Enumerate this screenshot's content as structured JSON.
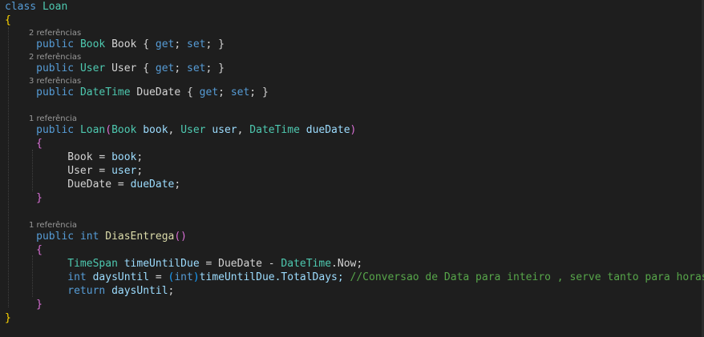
{
  "code": {
    "kw_class": "class",
    "class_name": "Loan",
    "open_brace": "{",
    "close_brace": "}",
    "ref_book": "2 referências",
    "prop_book_public": "public",
    "prop_book_type": "Book",
    "prop_book_name": "Book",
    "prop_open": "{",
    "kw_get": "get",
    "semi": ";",
    "kw_set": "set",
    "prop_close": "}",
    "ref_user": "2 referências",
    "prop_user_public": "public",
    "prop_user_type": "User",
    "prop_user_name": "User",
    "ref_duedate": "3 referências",
    "prop_duedate_public": "public",
    "prop_duedate_type": "DateTime",
    "prop_duedate_name": "DueDate",
    "ref_ctor": "1 referência",
    "ctor_public": "public",
    "ctor_name": "Loan",
    "ctor_lparen": "(",
    "ctor_p1_type": "Book",
    "ctor_p1_name": "book",
    "comma": ",",
    "ctor_p2_type": "User",
    "ctor_p2_name": "user",
    "ctor_p3_type": "DateTime",
    "ctor_p3_name": "dueDate",
    "ctor_rparen": ")",
    "ctor_open": "{",
    "assign1_lhs": "Book",
    "assign1_op": "=",
    "assign1_rhs": "book",
    "assign2_lhs": "User",
    "assign2_op": "=",
    "assign2_rhs": "user",
    "assign3_lhs": "DueDate",
    "assign3_op": "=",
    "assign3_rhs": "dueDate",
    "ctor_close": "}",
    "ref_method": "1 referência",
    "m_public": "public",
    "m_int": "int",
    "m_name": "DiasEntrega",
    "m_parens": "()",
    "m_open": "{",
    "s1_type": "TimeSpan",
    "s1_var": "timeUntilDue",
    "s1_eq": "=",
    "s1_lhs": "DueDate",
    "s1_minus": "-",
    "s1_dt": "DateTime",
    "s1_now": ".Now;",
    "s2_int": "int",
    "s2_var": "daysUntil",
    "s2_eq": "=",
    "s2_lparen": "(",
    "s2_cast": "int",
    "s2_rparen": ")",
    "s2_expr": "timeUntilDue.TotalDays;",
    "s2_comment": "//Conversao de Data para inteiro , serve tanto para horas dias",
    "s3_return": "return",
    "s3_var": "daysUntil",
    "m_close": "}",
    "class_close": "}"
  },
  "colors": {
    "background": "#1e1e1e",
    "keyword": "#569cd6",
    "type": "#4ec9b0",
    "method": "#dcdcaa",
    "parameter": "#9cdcfe",
    "comment": "#57a64a",
    "codelens": "#999999"
  }
}
